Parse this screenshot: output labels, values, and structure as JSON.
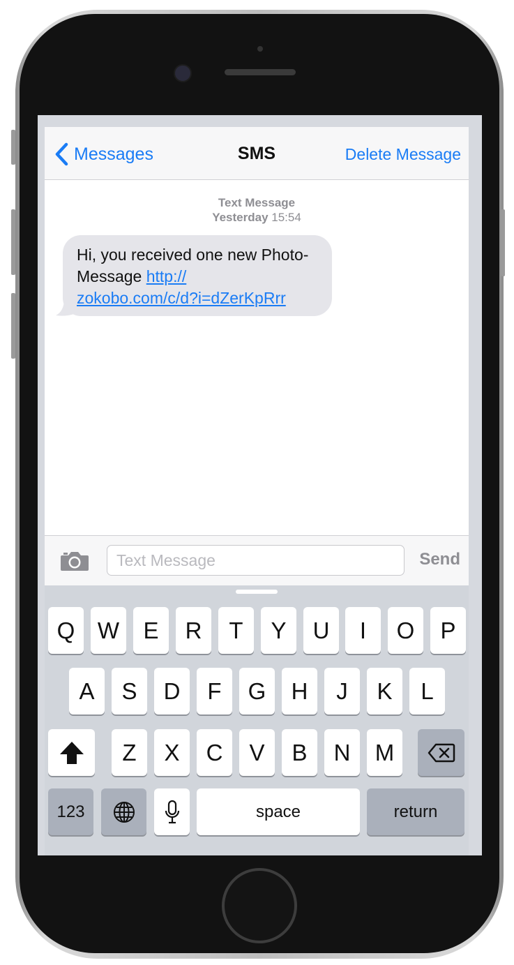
{
  "navbar": {
    "back_label": "Messages",
    "title": "SMS",
    "action_label": "Delete Message"
  },
  "thread": {
    "service_label": "Text Message",
    "date_label": "Yesterday",
    "time_label": "15:54",
    "message": {
      "text": "Hi,  you received one new Photo-Message ",
      "link_part1": "http://",
      "link_part2": "zokobo.com/c/d?i=dZerKpRrr"
    }
  },
  "composer": {
    "placeholder": "Text Message",
    "send_label": "Send",
    "camera_icon": "camera-icon"
  },
  "keyboard": {
    "row1": [
      "Q",
      "W",
      "E",
      "R",
      "T",
      "Y",
      "U",
      "I",
      "O",
      "P"
    ],
    "row2": [
      "A",
      "S",
      "D",
      "F",
      "G",
      "H",
      "J",
      "K",
      "L"
    ],
    "row3": [
      "Z",
      "X",
      "C",
      "V",
      "B",
      "N",
      "M"
    ],
    "numbers_label": "123",
    "space_label": "space",
    "return_label": "return",
    "icons": [
      "shift-icon",
      "backspace-icon",
      "globe-icon",
      "microphone-icon"
    ]
  },
  "colors": {
    "accent": "#1a7cf5",
    "bubble": "#e5e5ea",
    "keyboard_bg": "#d1d5db",
    "dark_key": "#aab0bb"
  }
}
